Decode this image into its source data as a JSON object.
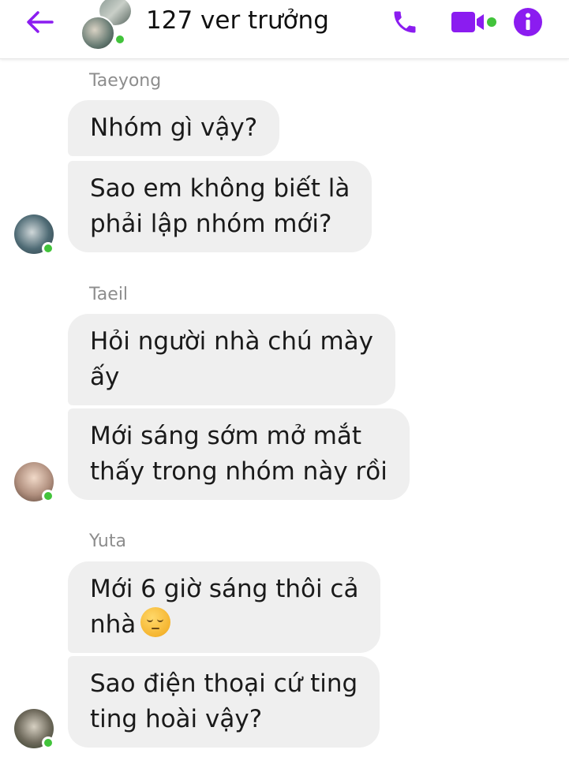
{
  "header": {
    "title": "127 ver trưởng",
    "accent_color": "#8b1cf0",
    "icons": [
      "back-arrow-icon",
      "phone-icon",
      "video-camera-icon",
      "info-icon"
    ]
  },
  "messages": [
    {
      "sender": "Taeyong",
      "bubbles": [
        "Nhóm gì vậy?",
        [
          "Sao em không biết là",
          "phải lập nhóm mới?"
        ]
      ]
    },
    {
      "sender": "Taeil",
      "bubbles": [
        [
          "Hỏi người nhà chú mày",
          "ấy"
        ],
        [
          "Mới sáng sớm mở mắt",
          "thấy trong nhóm này rồi"
        ]
      ]
    },
    {
      "sender": "Yuta",
      "bubbles": [
        [
          "Mới 6 giờ sáng thôi cả",
          "nhà"
        ],
        [
          "Sao điện thoại cứ ting",
          "ting hoài vậy?"
        ]
      ],
      "emoji": "pensive-face-emoji"
    }
  ]
}
